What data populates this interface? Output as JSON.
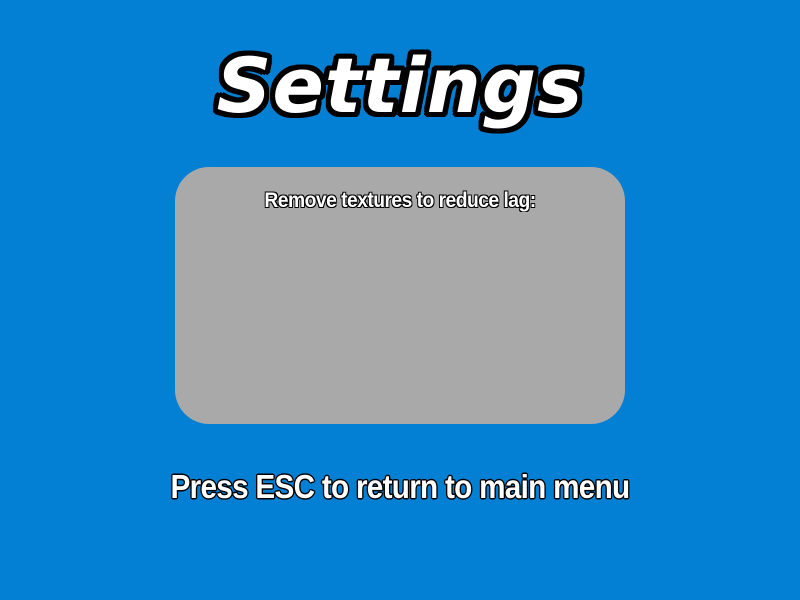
{
  "screen": {
    "background_color": "#0380d3",
    "title": "Settings",
    "panel": {
      "background_color": "#a9a9a9",
      "label": "Remove textures to reduce lag:"
    },
    "hint": "Press ESC to return to main menu"
  }
}
